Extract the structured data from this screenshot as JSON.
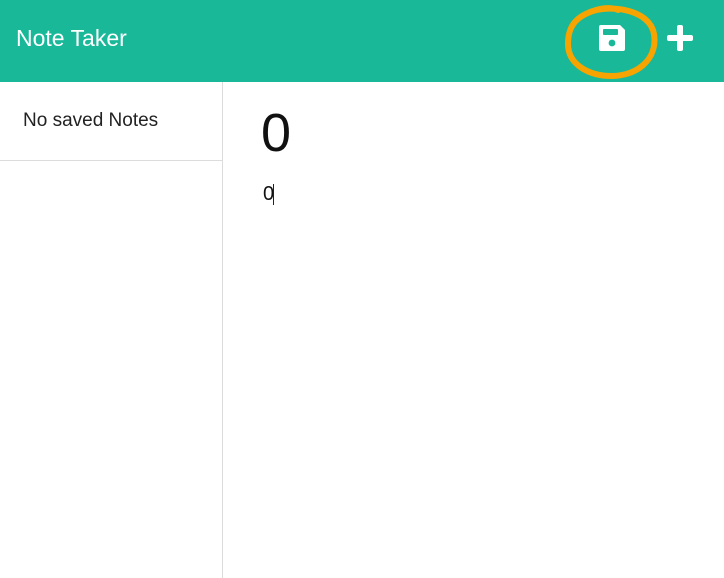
{
  "navbar": {
    "brand": "Note Taker",
    "save_icon": "floppy-disk-icon",
    "new_note_icon": "plus-icon",
    "annotation_color": "#f7a400",
    "background_color": "#19b899"
  },
  "sidebar": {
    "empty_message": "No saved Notes"
  },
  "editor": {
    "title_value": "0",
    "text_value": "0"
  }
}
